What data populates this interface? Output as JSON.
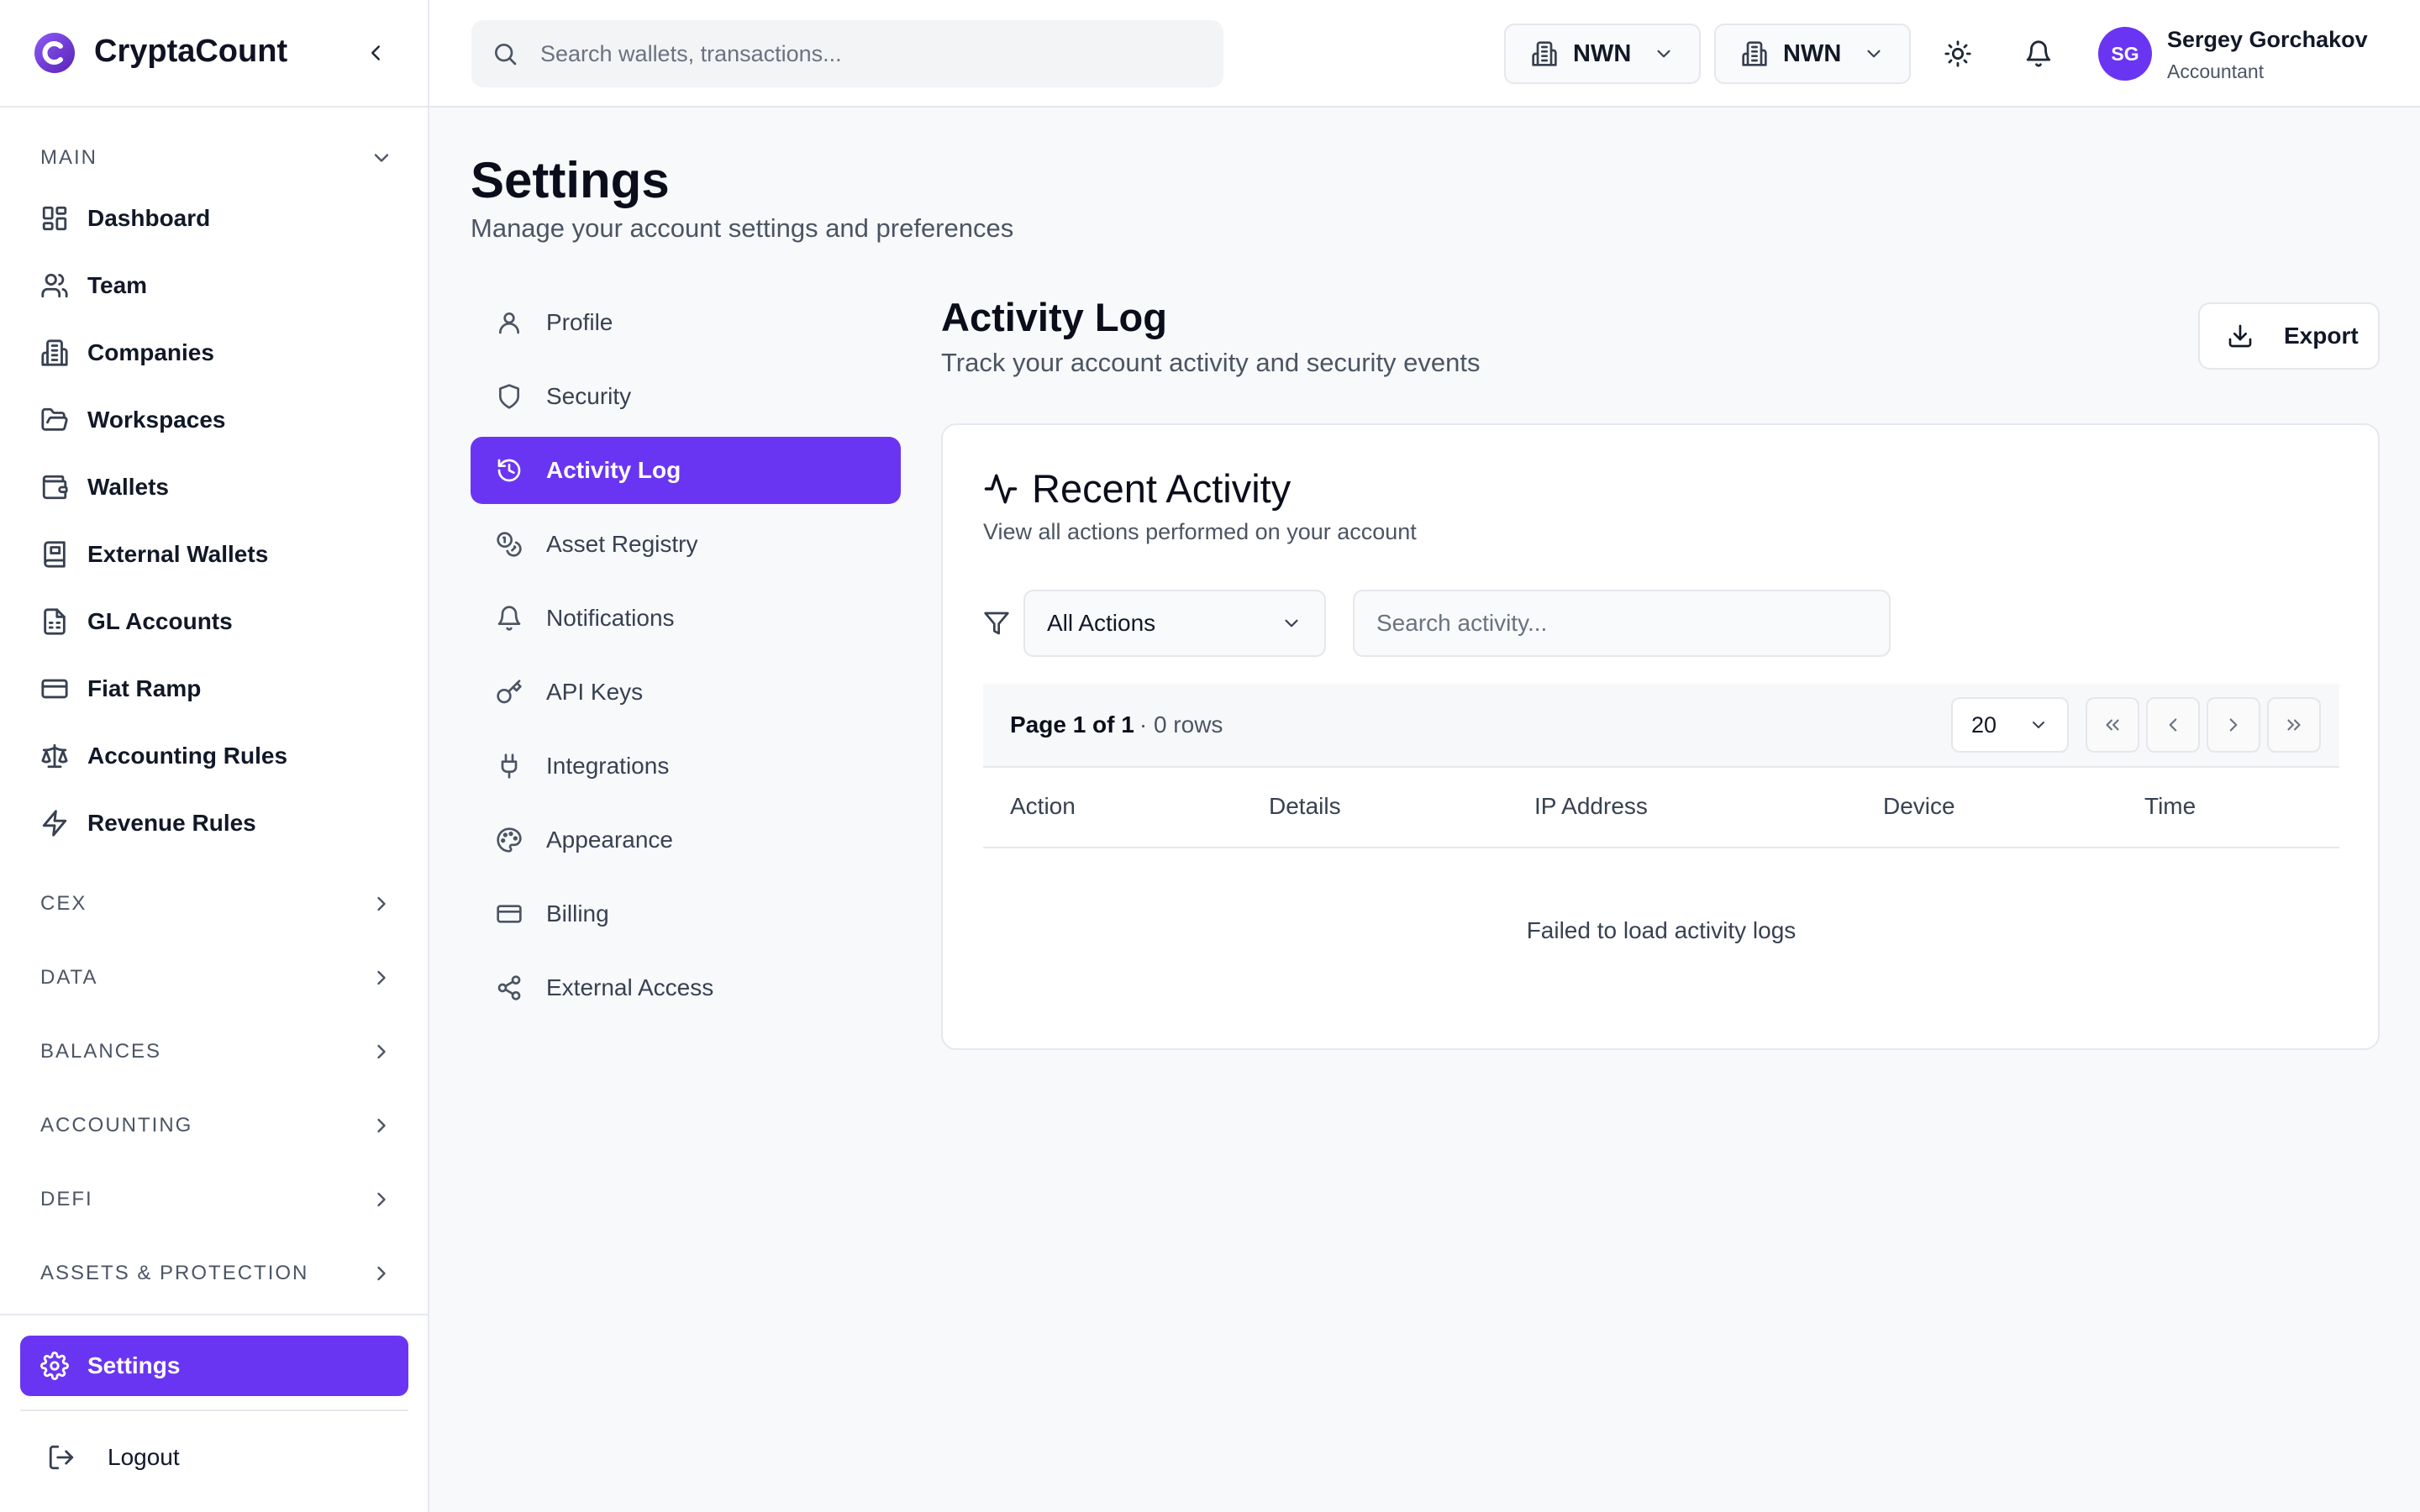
{
  "app": {
    "name": "CryptaCount"
  },
  "sidebar": {
    "sections": [
      {
        "label": "MAIN",
        "expanded": true
      },
      {
        "label": "CEX"
      },
      {
        "label": "DATA"
      },
      {
        "label": "BALANCES"
      },
      {
        "label": "ACCOUNTING"
      },
      {
        "label": "DEFI"
      },
      {
        "label": "ASSETS & PROTECTION"
      }
    ],
    "items": [
      {
        "label": "Dashboard",
        "icon": "dashboard-icon"
      },
      {
        "label": "Team",
        "icon": "users-icon"
      },
      {
        "label": "Companies",
        "icon": "building-icon"
      },
      {
        "label": "Workspaces",
        "icon": "folder-open-icon"
      },
      {
        "label": "Wallets",
        "icon": "wallet-icon"
      },
      {
        "label": "External Wallets",
        "icon": "book-icon"
      },
      {
        "label": "GL Accounts",
        "icon": "file-spreadsheet-icon"
      },
      {
        "label": "Fiat Ramp",
        "icon": "credit-card-icon"
      },
      {
        "label": "Accounting Rules",
        "icon": "scale-icon"
      },
      {
        "label": "Revenue Rules",
        "icon": "zap-icon"
      }
    ],
    "settings_label": "Settings",
    "logout_label": "Logout"
  },
  "topbar": {
    "search_placeholder": "Search wallets, transactions...",
    "org_selects": [
      "NWN",
      "NWN"
    ],
    "user": {
      "initials": "SG",
      "name": "Sergey Gorchakov",
      "role": "Accountant"
    }
  },
  "page": {
    "title": "Settings",
    "subtitle": "Manage your account settings and preferences"
  },
  "settings_menu": [
    {
      "label": "Profile",
      "icon": "user-icon"
    },
    {
      "label": "Security",
      "icon": "shield-icon"
    },
    {
      "label": "Activity Log",
      "icon": "history-icon",
      "active": true
    },
    {
      "label": "Asset Registry",
      "icon": "coins-icon"
    },
    {
      "label": "Notifications",
      "icon": "bell-icon"
    },
    {
      "label": "API Keys",
      "icon": "key-icon"
    },
    {
      "label": "Integrations",
      "icon": "plug-icon"
    },
    {
      "label": "Appearance",
      "icon": "palette-icon"
    },
    {
      "label": "Billing",
      "icon": "credit-card-icon"
    },
    {
      "label": "External Access",
      "icon": "share-icon"
    }
  ],
  "content": {
    "title": "Activity Log",
    "subtitle": "Track your account activity and security events",
    "export_label": "Export",
    "card": {
      "title": "Recent Activity",
      "subtitle": "View all actions performed on your account",
      "filter_value": "All Actions",
      "search_placeholder": "Search activity...",
      "pager_text": "Page 1 of 1",
      "pager_rows": "· 0 rows",
      "page_size": "20",
      "columns": [
        "Action",
        "Details",
        "IP Address",
        "Device",
        "Time"
      ],
      "empty_message": "Failed to load activity logs"
    }
  },
  "colors": {
    "accent": "#6a35f2",
    "border": "#e6e8ee",
    "background": "#f8f9fb"
  }
}
